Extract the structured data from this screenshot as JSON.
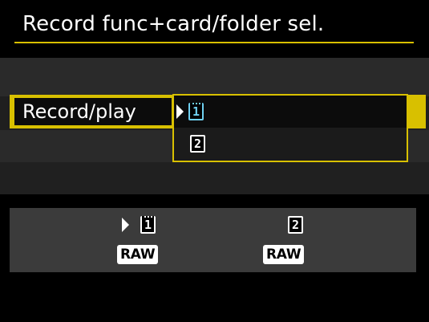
{
  "menu": {
    "title": "Record func+card/folder sel.",
    "selected_item_label": "Record/play",
    "options": [
      "1",
      "2"
    ],
    "selected_option": "1"
  },
  "info_panel": {
    "card1_label": "1",
    "card2_label": "2",
    "card1_quality": "RAW",
    "card2_quality": "RAW"
  },
  "colors": {
    "accent": "#d8c000",
    "selected_card": "#6fd0f0"
  }
}
